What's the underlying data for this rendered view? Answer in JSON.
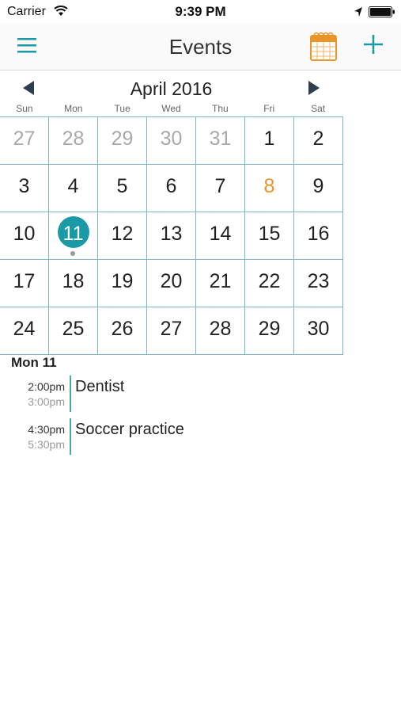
{
  "status_bar": {
    "carrier": "Carrier",
    "time": "9:39 PM"
  },
  "nav": {
    "title": "Events",
    "menu_icon": "hamburger-menu-icon",
    "calendar_icon": "calendar-icon",
    "add_icon": "plus-icon"
  },
  "calendar": {
    "month_title": "April 2016",
    "weekdays": [
      "Sun",
      "Mon",
      "Tue",
      "Wed",
      "Thu",
      "Fri",
      "Sat"
    ],
    "weeks": [
      [
        {
          "d": "27",
          "m": true
        },
        {
          "d": "28",
          "m": true
        },
        {
          "d": "29",
          "m": true
        },
        {
          "d": "30",
          "m": true
        },
        {
          "d": "31",
          "m": true
        },
        {
          "d": "1"
        },
        {
          "d": "2"
        }
      ],
      [
        {
          "d": "3"
        },
        {
          "d": "4"
        },
        {
          "d": "5"
        },
        {
          "d": "6"
        },
        {
          "d": "7"
        },
        {
          "d": "8",
          "today": true
        },
        {
          "d": "9"
        }
      ],
      [
        {
          "d": "10"
        },
        {
          "d": "11",
          "selected": true,
          "has_events": true
        },
        {
          "d": "12"
        },
        {
          "d": "13"
        },
        {
          "d": "14"
        },
        {
          "d": "15"
        },
        {
          "d": "16"
        }
      ],
      [
        {
          "d": "17"
        },
        {
          "d": "18"
        },
        {
          "d": "19"
        },
        {
          "d": "20"
        },
        {
          "d": "21"
        },
        {
          "d": "22"
        },
        {
          "d": "23"
        }
      ],
      [
        {
          "d": "24"
        },
        {
          "d": "25"
        },
        {
          "d": "26"
        },
        {
          "d": "27"
        },
        {
          "d": "28"
        },
        {
          "d": "29"
        },
        {
          "d": "30"
        }
      ]
    ],
    "colors": {
      "accent": "#1a9aa6",
      "today": "#e8962a",
      "grid": "#7fb6c4",
      "muted": "#a9a9a9"
    }
  },
  "agenda": {
    "date_label": "Mon 11",
    "events": [
      {
        "start": "2:00pm",
        "end": "3:00pm",
        "title": "Dentist"
      },
      {
        "start": "4:30pm",
        "end": "5:30pm",
        "title": "Soccer practice"
      }
    ]
  }
}
